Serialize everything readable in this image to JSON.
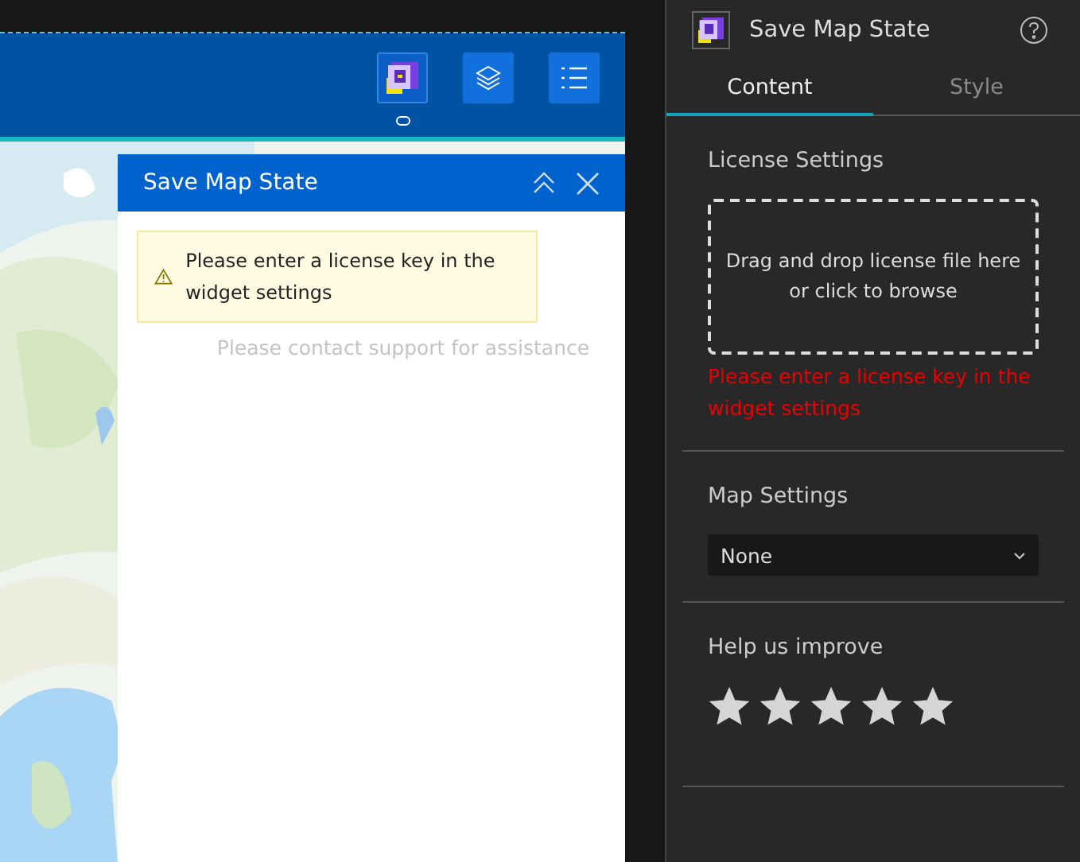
{
  "app": {
    "toolbar": [
      {
        "kind": "widget",
        "selected": true
      },
      {
        "kind": "layers",
        "selected": false
      },
      {
        "kind": "list",
        "selected": false
      }
    ],
    "panel": {
      "title": "Save Map State",
      "warning": "Please enter a license key in the widget settings",
      "note": "Please contact support for assistance"
    }
  },
  "settings": {
    "title": "Save Map State",
    "tabs": [
      {
        "label": "Content",
        "selected": true
      },
      {
        "label": "Style",
        "selected": false
      }
    ],
    "license": {
      "heading": "License Settings",
      "dropzone_line1": "Drag and drop license file here",
      "dropzone_line2": "or click to browse",
      "error": "Please enter a license key in the widget settings"
    },
    "map_settings": {
      "heading": "Map Settings",
      "value": "None"
    },
    "feedback": {
      "heading": "Help us improve",
      "stars": 5
    }
  }
}
